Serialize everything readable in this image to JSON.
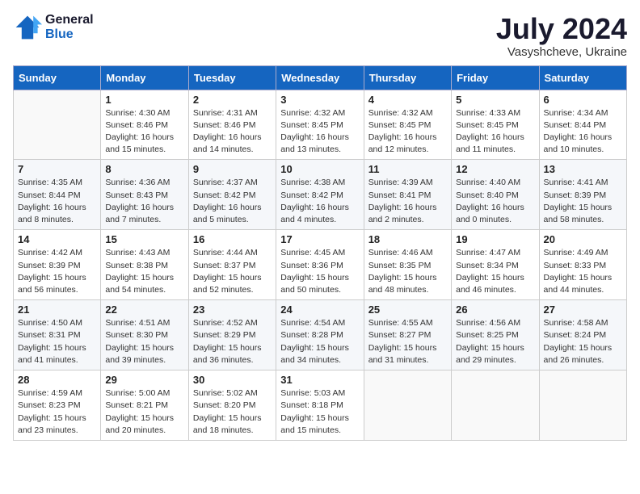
{
  "header": {
    "logo_line1": "General",
    "logo_line2": "Blue",
    "month_title": "July 2024",
    "location": "Vasyshcheve, Ukraine"
  },
  "weekdays": [
    "Sunday",
    "Monday",
    "Tuesday",
    "Wednesday",
    "Thursday",
    "Friday",
    "Saturday"
  ],
  "weeks": [
    [
      {
        "day": "",
        "info": ""
      },
      {
        "day": "1",
        "info": "Sunrise: 4:30 AM\nSunset: 8:46 PM\nDaylight: 16 hours\nand 15 minutes."
      },
      {
        "day": "2",
        "info": "Sunrise: 4:31 AM\nSunset: 8:46 PM\nDaylight: 16 hours\nand 14 minutes."
      },
      {
        "day": "3",
        "info": "Sunrise: 4:32 AM\nSunset: 8:45 PM\nDaylight: 16 hours\nand 13 minutes."
      },
      {
        "day": "4",
        "info": "Sunrise: 4:32 AM\nSunset: 8:45 PM\nDaylight: 16 hours\nand 12 minutes."
      },
      {
        "day": "5",
        "info": "Sunrise: 4:33 AM\nSunset: 8:45 PM\nDaylight: 16 hours\nand 11 minutes."
      },
      {
        "day": "6",
        "info": "Sunrise: 4:34 AM\nSunset: 8:44 PM\nDaylight: 16 hours\nand 10 minutes."
      }
    ],
    [
      {
        "day": "7",
        "info": "Sunrise: 4:35 AM\nSunset: 8:44 PM\nDaylight: 16 hours\nand 8 minutes."
      },
      {
        "day": "8",
        "info": "Sunrise: 4:36 AM\nSunset: 8:43 PM\nDaylight: 16 hours\nand 7 minutes."
      },
      {
        "day": "9",
        "info": "Sunrise: 4:37 AM\nSunset: 8:42 PM\nDaylight: 16 hours\nand 5 minutes."
      },
      {
        "day": "10",
        "info": "Sunrise: 4:38 AM\nSunset: 8:42 PM\nDaylight: 16 hours\nand 4 minutes."
      },
      {
        "day": "11",
        "info": "Sunrise: 4:39 AM\nSunset: 8:41 PM\nDaylight: 16 hours\nand 2 minutes."
      },
      {
        "day": "12",
        "info": "Sunrise: 4:40 AM\nSunset: 8:40 PM\nDaylight: 16 hours\nand 0 minutes."
      },
      {
        "day": "13",
        "info": "Sunrise: 4:41 AM\nSunset: 8:39 PM\nDaylight: 15 hours\nand 58 minutes."
      }
    ],
    [
      {
        "day": "14",
        "info": "Sunrise: 4:42 AM\nSunset: 8:39 PM\nDaylight: 15 hours\nand 56 minutes."
      },
      {
        "day": "15",
        "info": "Sunrise: 4:43 AM\nSunset: 8:38 PM\nDaylight: 15 hours\nand 54 minutes."
      },
      {
        "day": "16",
        "info": "Sunrise: 4:44 AM\nSunset: 8:37 PM\nDaylight: 15 hours\nand 52 minutes."
      },
      {
        "day": "17",
        "info": "Sunrise: 4:45 AM\nSunset: 8:36 PM\nDaylight: 15 hours\nand 50 minutes."
      },
      {
        "day": "18",
        "info": "Sunrise: 4:46 AM\nSunset: 8:35 PM\nDaylight: 15 hours\nand 48 minutes."
      },
      {
        "day": "19",
        "info": "Sunrise: 4:47 AM\nSunset: 8:34 PM\nDaylight: 15 hours\nand 46 minutes."
      },
      {
        "day": "20",
        "info": "Sunrise: 4:49 AM\nSunset: 8:33 PM\nDaylight: 15 hours\nand 44 minutes."
      }
    ],
    [
      {
        "day": "21",
        "info": "Sunrise: 4:50 AM\nSunset: 8:31 PM\nDaylight: 15 hours\nand 41 minutes."
      },
      {
        "day": "22",
        "info": "Sunrise: 4:51 AM\nSunset: 8:30 PM\nDaylight: 15 hours\nand 39 minutes."
      },
      {
        "day": "23",
        "info": "Sunrise: 4:52 AM\nSunset: 8:29 PM\nDaylight: 15 hours\nand 36 minutes."
      },
      {
        "day": "24",
        "info": "Sunrise: 4:54 AM\nSunset: 8:28 PM\nDaylight: 15 hours\nand 34 minutes."
      },
      {
        "day": "25",
        "info": "Sunrise: 4:55 AM\nSunset: 8:27 PM\nDaylight: 15 hours\nand 31 minutes."
      },
      {
        "day": "26",
        "info": "Sunrise: 4:56 AM\nSunset: 8:25 PM\nDaylight: 15 hours\nand 29 minutes."
      },
      {
        "day": "27",
        "info": "Sunrise: 4:58 AM\nSunset: 8:24 PM\nDaylight: 15 hours\nand 26 minutes."
      }
    ],
    [
      {
        "day": "28",
        "info": "Sunrise: 4:59 AM\nSunset: 8:23 PM\nDaylight: 15 hours\nand 23 minutes."
      },
      {
        "day": "29",
        "info": "Sunrise: 5:00 AM\nSunset: 8:21 PM\nDaylight: 15 hours\nand 20 minutes."
      },
      {
        "day": "30",
        "info": "Sunrise: 5:02 AM\nSunset: 8:20 PM\nDaylight: 15 hours\nand 18 minutes."
      },
      {
        "day": "31",
        "info": "Sunrise: 5:03 AM\nSunset: 8:18 PM\nDaylight: 15 hours\nand 15 minutes."
      },
      {
        "day": "",
        "info": ""
      },
      {
        "day": "",
        "info": ""
      },
      {
        "day": "",
        "info": ""
      }
    ]
  ]
}
